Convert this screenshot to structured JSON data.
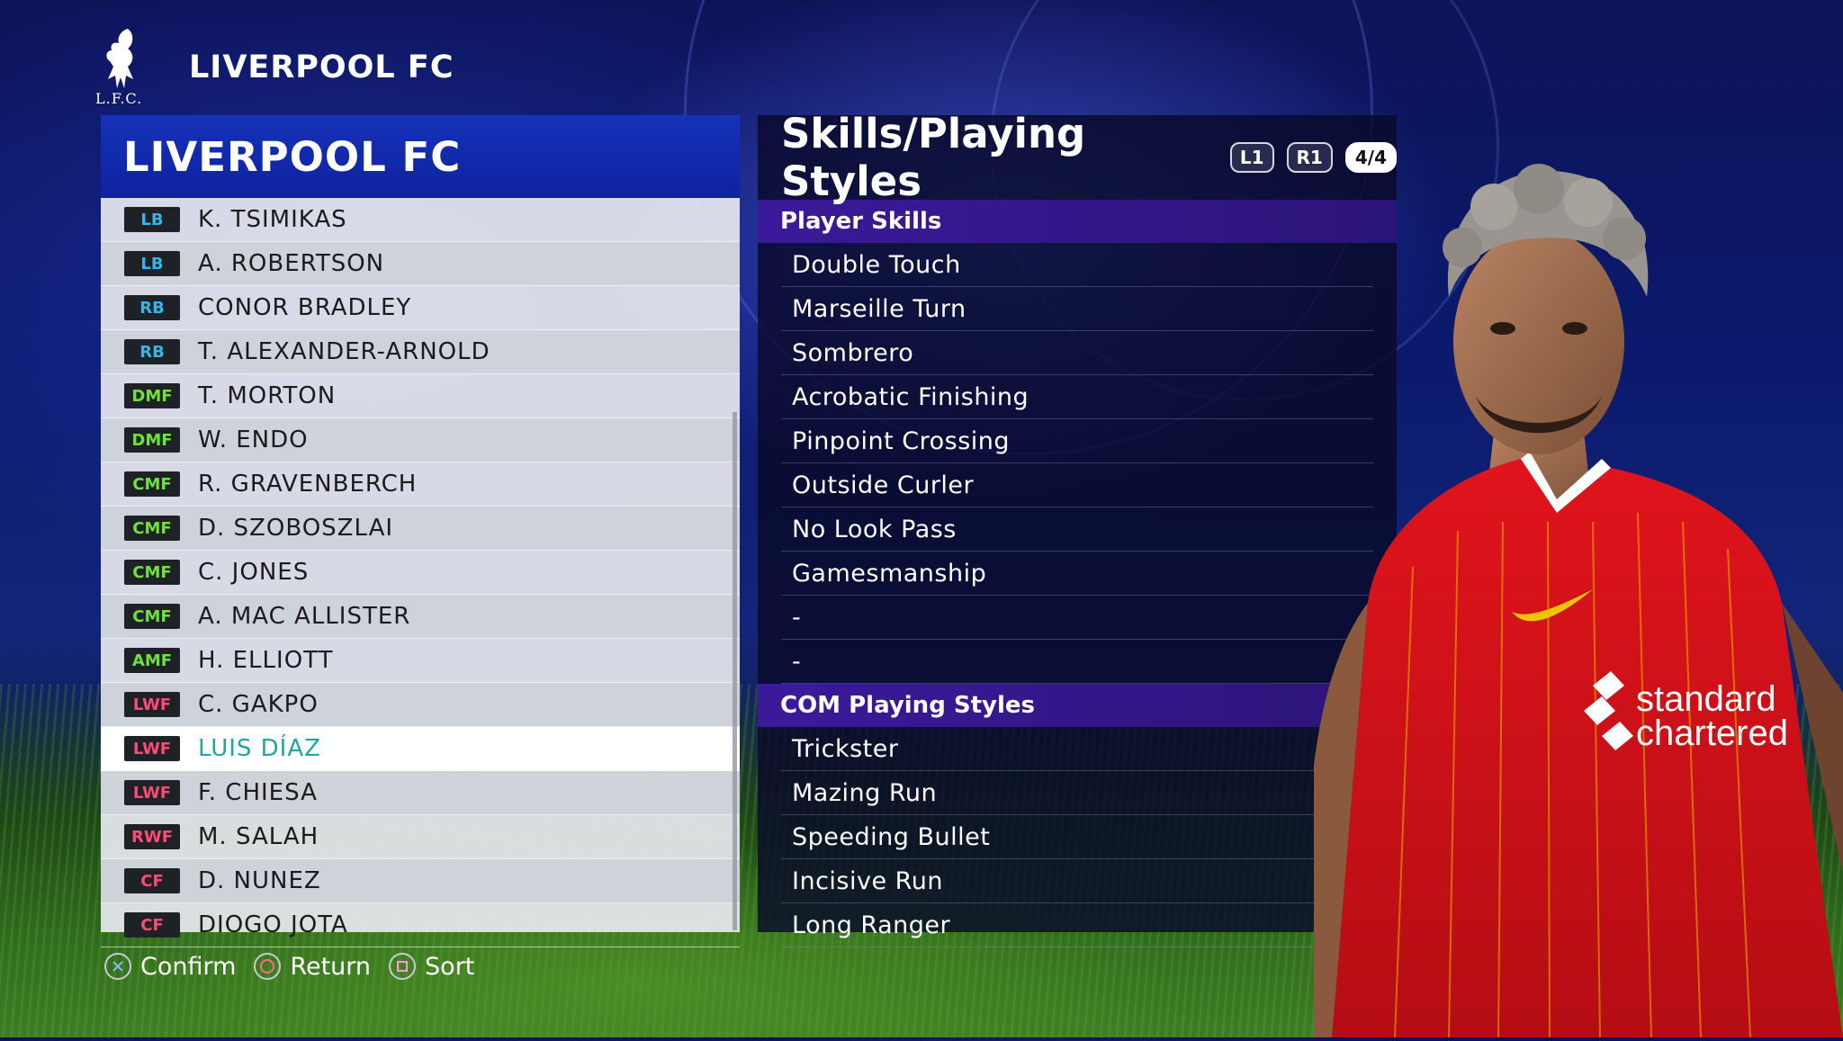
{
  "header": {
    "title": "LIVERPOOL FC",
    "crest_text": "L.F.C."
  },
  "squad": {
    "title": "LIVERPOOL FC",
    "players": [
      {
        "pos": "LB",
        "name": "K. TSIMIKAS"
      },
      {
        "pos": "LB",
        "name": "A. ROBERTSON"
      },
      {
        "pos": "RB",
        "name": "CONOR BRADLEY"
      },
      {
        "pos": "RB",
        "name": "T. ALEXANDER-ARNOLD"
      },
      {
        "pos": "DMF",
        "name": "T. MORTON"
      },
      {
        "pos": "DMF",
        "name": "W. ENDO"
      },
      {
        "pos": "CMF",
        "name": "R. GRAVENBERCH"
      },
      {
        "pos": "CMF",
        "name": "D. SZOBOSZLAI"
      },
      {
        "pos": "CMF",
        "name": "C. JONES"
      },
      {
        "pos": "CMF",
        "name": "A. MAC ALLISTER"
      },
      {
        "pos": "AMF",
        "name": "H. ELLIOTT"
      },
      {
        "pos": "LWF",
        "name": "C. GAKPO"
      },
      {
        "pos": "LWF",
        "name": "LUIS DÍAZ"
      },
      {
        "pos": "LWF",
        "name": "F. CHIESA"
      },
      {
        "pos": "RWF",
        "name": "M. SALAH"
      },
      {
        "pos": "CF",
        "name": "D. NUNEZ"
      },
      {
        "pos": "CF",
        "name": "DIOGO JOTA"
      }
    ],
    "selected_name": "LUIS DÍAZ"
  },
  "details": {
    "title": "Skills/Playing Styles",
    "badge_l1": "L1",
    "badge_r1": "R1",
    "page": "4/4",
    "player_skills_header": "Player Skills",
    "player_skills": [
      "Double Touch",
      "Marseille Turn",
      "Sombrero",
      "Acrobatic Finishing",
      "Pinpoint Crossing",
      "Outside Curler",
      "No Look Pass",
      "Gamesmanship",
      "-",
      "-"
    ],
    "com_styles_header": "COM Playing Styles",
    "com_styles": [
      "Trickster",
      "Mazing Run",
      "Speeding Bullet",
      "Incisive Run",
      "Long Ranger"
    ]
  },
  "footer": {
    "confirm": "Confirm",
    "return": "Return",
    "sort": "Sort"
  },
  "kit": {
    "sponsor_line1": "standard",
    "sponsor_line2": "chartered"
  },
  "colors": {
    "def": "#36b5e8",
    "mid": "#6ee23c",
    "fwd": "#ff4a76",
    "selected": "#1fa79e",
    "header_blue": "#1532b8",
    "section_purple": "#3b1a9a"
  }
}
